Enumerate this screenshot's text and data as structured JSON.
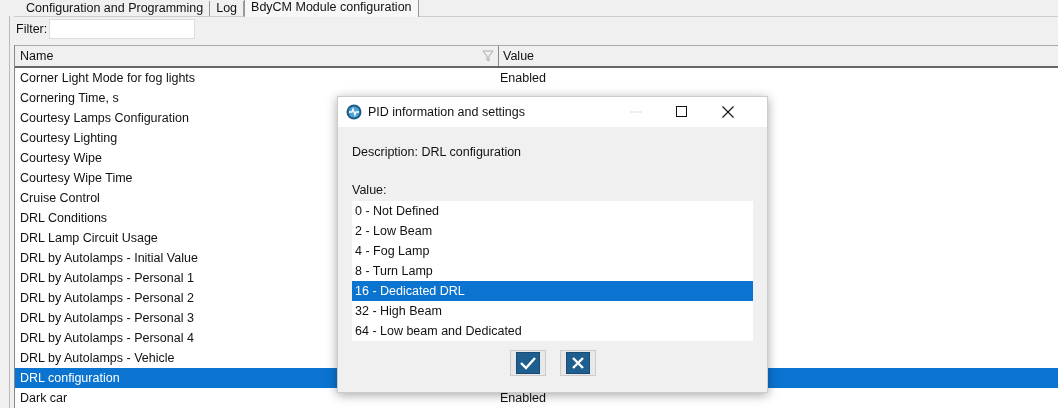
{
  "tabs": [
    {
      "label": "Configuration and Programming",
      "selected": false
    },
    {
      "label": "Log",
      "selected": false
    },
    {
      "label": "BdyCM Module configuration",
      "selected": true
    }
  ],
  "filter": {
    "label": "Filter:"
  },
  "table": {
    "columns": [
      "Name",
      "Value"
    ],
    "rows": [
      {
        "name": "Corner Light Mode for fog lights",
        "value": "Enabled",
        "selected": false
      },
      {
        "name": "Cornering Time, s",
        "selected": false
      },
      {
        "name": "Courtesy Lamps Configuration",
        "selected": false
      },
      {
        "name": "Courtesy Lighting",
        "selected": false
      },
      {
        "name": "Courtesy Wipe",
        "selected": false
      },
      {
        "name": "Courtesy Wipe Time",
        "selected": false
      },
      {
        "name": "Cruise Control",
        "selected": false
      },
      {
        "name": "DRL Conditions",
        "selected": false
      },
      {
        "name": "DRL Lamp Circuit Usage",
        "selected": false
      },
      {
        "name": "DRL by Autolamps - Initial Value",
        "selected": false
      },
      {
        "name": "DRL by Autolamps - Personal 1",
        "selected": false
      },
      {
        "name": "DRL by Autolamps - Personal 2",
        "selected": false
      },
      {
        "name": "DRL by Autolamps - Personal 3",
        "selected": false
      },
      {
        "name": "DRL by Autolamps - Personal 4",
        "selected": false
      },
      {
        "name": "DRL by Autolamps - Vehicle",
        "selected": false
      },
      {
        "name": "DRL configuration",
        "selected": true
      },
      {
        "name": "Dark car",
        "value": "Enabled",
        "selected": false
      }
    ]
  },
  "dialog": {
    "title": "PID information and settings",
    "description": "Description: DRL configuration",
    "value_label": "Value:",
    "options": [
      {
        "label": "0 - Not Defined",
        "selected": false
      },
      {
        "label": "2 - Low Beam",
        "selected": false
      },
      {
        "label": "4 - Fog Lamp",
        "selected": false
      },
      {
        "label": "8 - Turn Lamp",
        "selected": false
      },
      {
        "label": "16 - Dedicated DRL",
        "selected": true
      },
      {
        "label": "32 - High Beam",
        "selected": false
      },
      {
        "label": "64 - Low beam and Dedicated",
        "selected": false
      }
    ]
  }
}
